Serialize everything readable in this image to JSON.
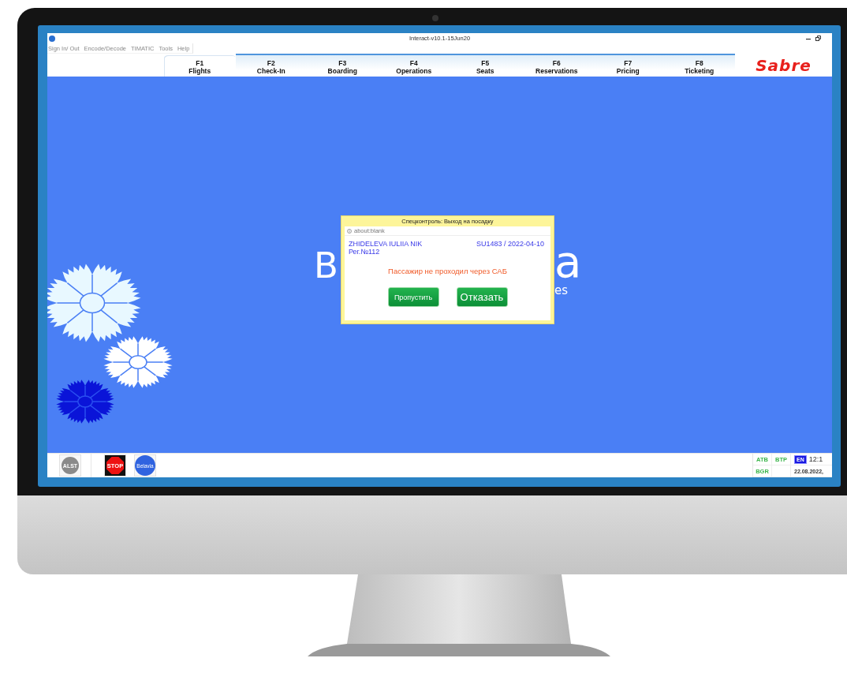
{
  "window": {
    "title": "Interact-v10.1-15Jun20"
  },
  "menu": [
    {
      "label": "Sign In/ Out",
      "disabled": true
    },
    {
      "label": "Encode/Decode",
      "disabled": true
    },
    {
      "label": "TIMATIC",
      "disabled": true
    },
    {
      "label": "Tools",
      "disabled": true
    },
    {
      "label": "Help",
      "disabled": true
    }
  ],
  "tabs": [
    {
      "key": "F1",
      "label": "Flights",
      "selected": true
    },
    {
      "key": "F2",
      "label": "Check-In",
      "selected": false
    },
    {
      "key": "F3",
      "label": "Boarding",
      "selected": false
    },
    {
      "key": "F4",
      "label": "Operations",
      "selected": false
    },
    {
      "key": "F5",
      "label": "Seats",
      "selected": false
    },
    {
      "key": "F6",
      "label": "Reservations",
      "selected": false
    },
    {
      "key": "F7",
      "label": "Pricing",
      "selected": false
    },
    {
      "key": "F8",
      "label": "Ticketing",
      "selected": false
    }
  ],
  "brand": "Sabre",
  "wallpaper": {
    "logo_fragments": [
      "B",
      "a"
    ],
    "subtitle_fragment": "es"
  },
  "dialog": {
    "title": "Спецконтроль: Выход на посадку",
    "address": "about:blank",
    "passenger": "ZHIDELEVA IULIIA NIK",
    "registration": "Рег.№112",
    "flight": "SU1483 / 2022-04-10",
    "message": "Пассажир не проходил через САБ",
    "buttons": [
      {
        "label": "Пропустить",
        "kind": "small"
      },
      {
        "label": "Отказать",
        "kind": "large"
      }
    ]
  },
  "toolbar": [
    {
      "label": "ALST",
      "kind": "grey"
    },
    {
      "label": "STOP",
      "kind": "stop"
    },
    {
      "label": "Belavia",
      "kind": "round"
    }
  ],
  "status": {
    "indicators": [
      "ATB",
      "BTP",
      "BGR"
    ],
    "language": "EN",
    "time": "12:1",
    "date": "22.08.2022,"
  }
}
